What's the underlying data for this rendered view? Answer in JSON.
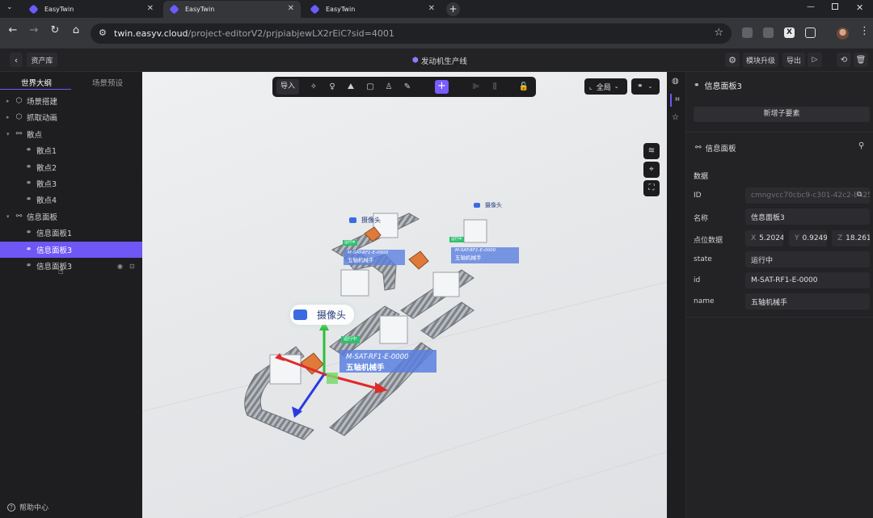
{
  "browser": {
    "tabs": [
      {
        "label": "EasyTwin"
      },
      {
        "label": "EasyTwin"
      },
      {
        "label": "EasyTwin"
      }
    ],
    "url_host": "twin.easyv.cloud",
    "url_path": "/project-editorV2/prjpiabjewLX2rEiC?sid=4001"
  },
  "header": {
    "back_label": "资产库",
    "project_title": "发动机生产线",
    "upgrade_label": "模块升级",
    "export_label": "导出"
  },
  "left_panel": {
    "tabs": [
      "世界大纲",
      "场景预设"
    ],
    "tree": [
      {
        "label": "场景搭建",
        "level": 0,
        "icon": "cube-icon"
      },
      {
        "label": "抓取动画",
        "level": 0,
        "icon": "cube-icon"
      },
      {
        "label": "散点",
        "level": 0,
        "icon": "group-icon"
      },
      {
        "label": "散点1",
        "level": 1,
        "icon": "link-icon"
      },
      {
        "label": "散点2",
        "level": 1,
        "icon": "link-icon"
      },
      {
        "label": "散点3",
        "level": 1,
        "icon": "link-icon"
      },
      {
        "label": "散点4",
        "level": 1,
        "icon": "link-icon"
      },
      {
        "label": "信息面板",
        "level": 0,
        "icon": "group-icon"
      },
      {
        "label": "信息面板1",
        "level": 1,
        "icon": "link-icon"
      },
      {
        "label": "信息面板3",
        "level": 1,
        "icon": "link-icon",
        "selected": true
      },
      {
        "label": "信息面板3",
        "level": 1,
        "icon": "link-icon",
        "hovered": true
      }
    ],
    "help_label": "帮助中心"
  },
  "viewport": {
    "toolbar": {
      "import_label": "导入"
    },
    "view_select": "全局",
    "scene": {
      "camera_label_main": "摄像头",
      "camera_label_small_1": "摄像头",
      "camera_label_small_2": "摄像头",
      "panel_main": {
        "status": "运行中",
        "id": "M-SAT-RF1-E-0000",
        "name": "五轴机械手"
      },
      "panel_small_1": {
        "status": "运行中",
        "id": "M-SAT-RF1-E-0000",
        "name": "五轴机械手"
      },
      "panel_small_2": {
        "status": "运行中",
        "id": "M-SAT-RF1-E-0000",
        "name": "五轴机械手"
      }
    }
  },
  "right_panel": {
    "title": "信息面板3",
    "add_child_label": "新增子要素",
    "component_label": "信息面板",
    "section_label": "数据",
    "fields": {
      "id_label": "ID",
      "id_value": "cmngvcc70cbc9-c301-42c2-ba25",
      "name_label": "名称",
      "name_value": "信息面板3",
      "point_label": "点位数据",
      "x_label": "X",
      "x_value": "5.2024",
      "y_label": "Y",
      "y_value": "0.9249",
      "z_label": "Z",
      "z_value": "18.261",
      "state_label": "state",
      "state_value": "运行中",
      "id2_label": "id",
      "id2_value": "M-SAT-RF1-E-0000",
      "name2_label": "name",
      "name2_value": "五轴机械手"
    }
  },
  "colors": {
    "accent": "#6e57f5",
    "panel_blue": "#5b7fe0",
    "status_green": "#2fbf71"
  }
}
